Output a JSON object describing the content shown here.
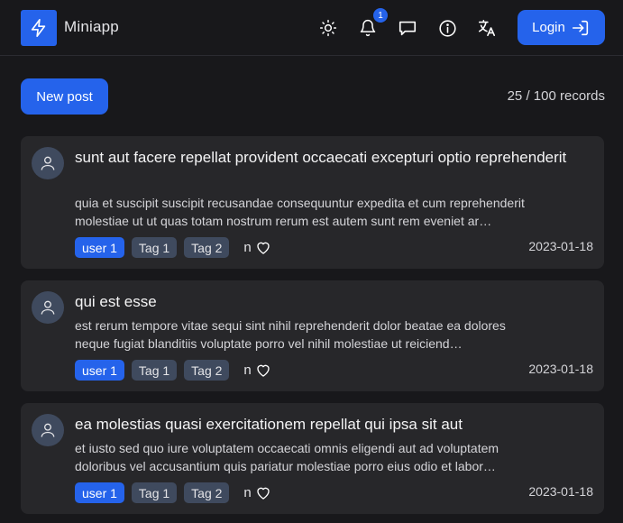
{
  "app": {
    "name": "Miniapp"
  },
  "header": {
    "notification_count": "1",
    "login_label": "Login"
  },
  "toolbar": {
    "new_post_label": "New post",
    "records": "25 / 100 records"
  },
  "posts": [
    {
      "title": "sunt aut facere repellat provident occaecati excepturi optio reprehenderit",
      "body_line1": "quia et suscipit suscipit recusandae consequuntur expedita et cum reprehenderit",
      "body_line2": "molestiae ut ut quas totam nostrum rerum est autem sunt rem eveniet ar…",
      "tags": [
        "user 1",
        "Tag 1",
        "Tag 2"
      ],
      "likes": "n",
      "date": "2023-01-18"
    },
    {
      "title": "qui est esse",
      "body_line1": "est rerum tempore vitae sequi sint nihil reprehenderit dolor beatae ea dolores",
      "body_line2": "neque fugiat blanditiis voluptate porro vel nihil molestiae ut reiciend…",
      "tags": [
        "user 1",
        "Tag 1",
        "Tag 2"
      ],
      "likes": "n",
      "date": "2023-01-18"
    },
    {
      "title": "ea molestias quasi exercitationem repellat qui ipsa sit aut",
      "body_line1": "et iusto sed quo iure voluptatem occaecati omnis eligendi aut ad voluptatem",
      "body_line2": "doloribus vel accusantium quis pariatur molestiae porro eius odio et labor…",
      "tags": [
        "user 1",
        "Tag 1",
        "Tag 2"
      ],
      "likes": "n",
      "date": "2023-01-18"
    }
  ],
  "colors": {
    "accent": "#2563eb",
    "background": "#18181b",
    "card": "#27272a",
    "tag": "#3f4a5e"
  },
  "icons": [
    "bolt-icon",
    "sun-icon",
    "bell-icon",
    "chat-icon",
    "info-icon",
    "translate-icon",
    "login-icon",
    "user-icon",
    "heart-icon"
  ]
}
